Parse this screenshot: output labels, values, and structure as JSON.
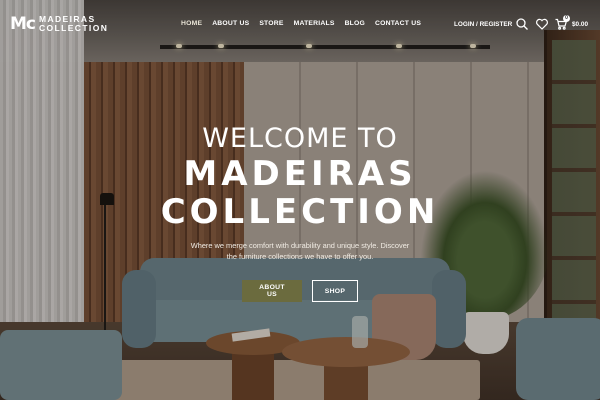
{
  "brand": {
    "mark": "Mc",
    "name_line1": "MADEIRAS",
    "name_line2": "COLLECTION"
  },
  "nav": {
    "items": [
      "HOME",
      "ABOUT US",
      "STORE",
      "MATERIALS",
      "BLOG",
      "CONTACT US"
    ]
  },
  "account": {
    "login_label": "LOGIN / REGISTER",
    "cart_count": "0",
    "cart_total": "$0.00"
  },
  "hero": {
    "eyebrow": "WELCOME TO",
    "title_line1": "MADEIRAS",
    "title_line2": "COLLECTION",
    "subtitle_line1": "Where we merge comfort with durability and unique style. Discover",
    "subtitle_line2": "the furniture collections we have to offer you.",
    "primary_button": "ABOUT US",
    "secondary_button": "SHOP"
  },
  "icons": {
    "search": "search-icon",
    "wishlist": "heart-icon",
    "cart": "cart-icon"
  },
  "colors": {
    "primary_button": "#6b6b3e",
    "text": "#ffffff"
  }
}
